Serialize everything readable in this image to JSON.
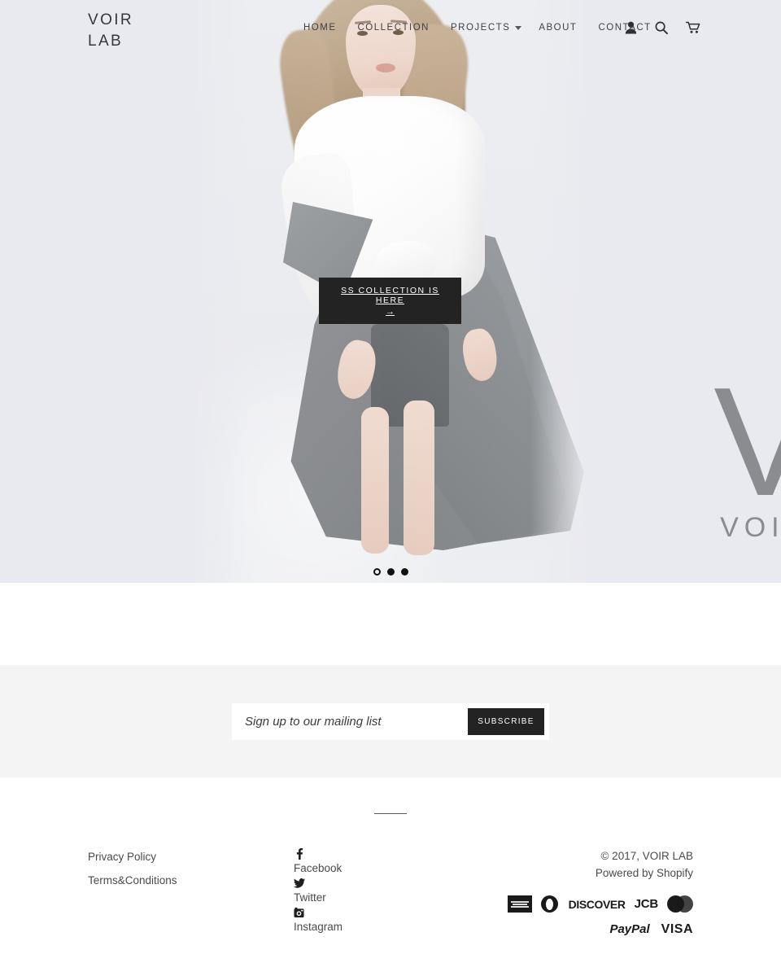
{
  "site": {
    "logo_line1": "VOIR",
    "logo_line2": "LAB",
    "accent_dark": "#232323",
    "hero_bg": "#e9eaef",
    "newsletter_bg": "#f4f4f5"
  },
  "nav": {
    "items": [
      {
        "label": "HOME"
      },
      {
        "label": "COLLECTION"
      },
      {
        "label": "PROJECTS",
        "has_dropdown": true
      },
      {
        "label": "ABOUT"
      },
      {
        "label": "CONTACT"
      }
    ],
    "icons": [
      {
        "name": "account-icon",
        "title": "Account"
      },
      {
        "name": "search-icon",
        "title": "Search"
      },
      {
        "name": "cart-icon",
        "title": "Cart"
      }
    ]
  },
  "hero": {
    "cta_label": "SS COLLECTION IS HERE",
    "cta_arrow": "→",
    "watermark_mark": "V",
    "watermark_word": "VOIR",
    "slides": [
      {
        "index": 1,
        "active": true
      },
      {
        "index": 2,
        "active": false
      },
      {
        "index": 3,
        "active": false
      }
    ]
  },
  "newsletter": {
    "placeholder": "Sign up to our mailing list",
    "value": "",
    "subscribe_label": "SUBSCRIBE"
  },
  "footer": {
    "links": [
      {
        "label": "Privacy Policy"
      },
      {
        "label": "Terms&Conditions"
      }
    ],
    "social": [
      {
        "label": "Facebook",
        "icon": "facebook-icon"
      },
      {
        "label": "Twitter",
        "icon": "twitter-icon"
      },
      {
        "label": "Instagram",
        "icon": "instagram-icon"
      }
    ],
    "copyright": "© 2017, VOIR LAB",
    "powered_prefix": "Powered by ",
    "powered_link": "Shopify",
    "payments_row1": [
      {
        "name": "american-express",
        "label": "AMERICAN EXPRESS"
      },
      {
        "name": "diners-club",
        "label": "Diners Club"
      },
      {
        "name": "discover",
        "label": "DISCOVER"
      },
      {
        "name": "jcb",
        "label": "JCB"
      },
      {
        "name": "mastercard",
        "label": "MasterCard"
      }
    ],
    "payments_row2": [
      {
        "name": "paypal",
        "label": "PayPal"
      },
      {
        "name": "visa",
        "label": "VISA"
      }
    ]
  }
}
